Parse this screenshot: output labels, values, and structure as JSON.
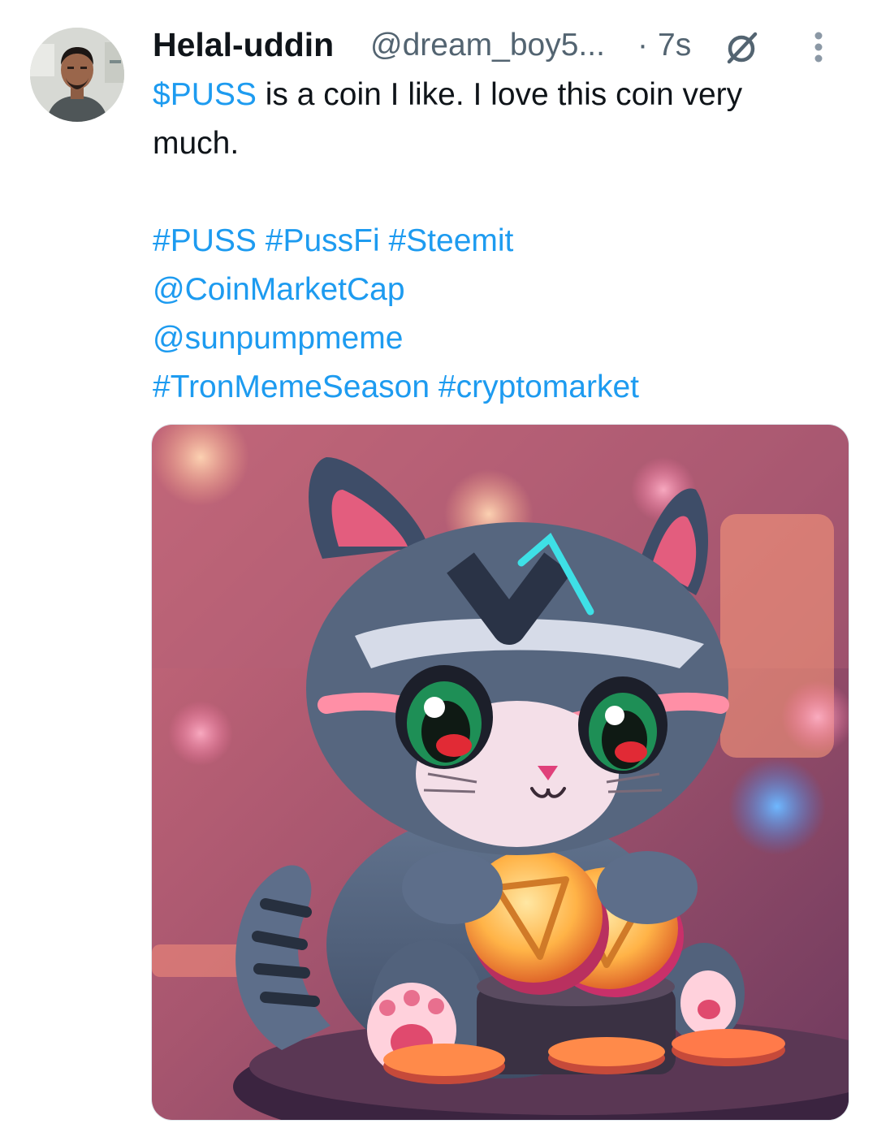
{
  "tweet": {
    "author_name": "Helal-uddin",
    "author_handle": "@dream_boy5...",
    "separator": "·",
    "time_ago": "7s",
    "body_lines": [
      {
        "cashtag": "$PUSS",
        "rest": " is a coin I like. I love this coin very"
      },
      {
        "text": "much."
      }
    ],
    "tag_lines": [
      {
        "tags": [
          "#PUSS",
          "#PussFi",
          "#Steemit"
        ]
      },
      {
        "tags": [
          "@CoinMarketCap"
        ]
      },
      {
        "tags": [
          "@sunpumpmeme"
        ]
      },
      {
        "tags": [
          "#TronMemeSeason",
          "#cryptomarket"
        ]
      }
    ],
    "icons": {
      "grok": "grok-icon",
      "more": "more-vertical-icon",
      "avatar": "avatar"
    },
    "media": "cartoon-cat-holding-tron-coins"
  },
  "colors": {
    "link": "#1d9bf0",
    "text": "#0f1419",
    "muted": "#536471"
  }
}
